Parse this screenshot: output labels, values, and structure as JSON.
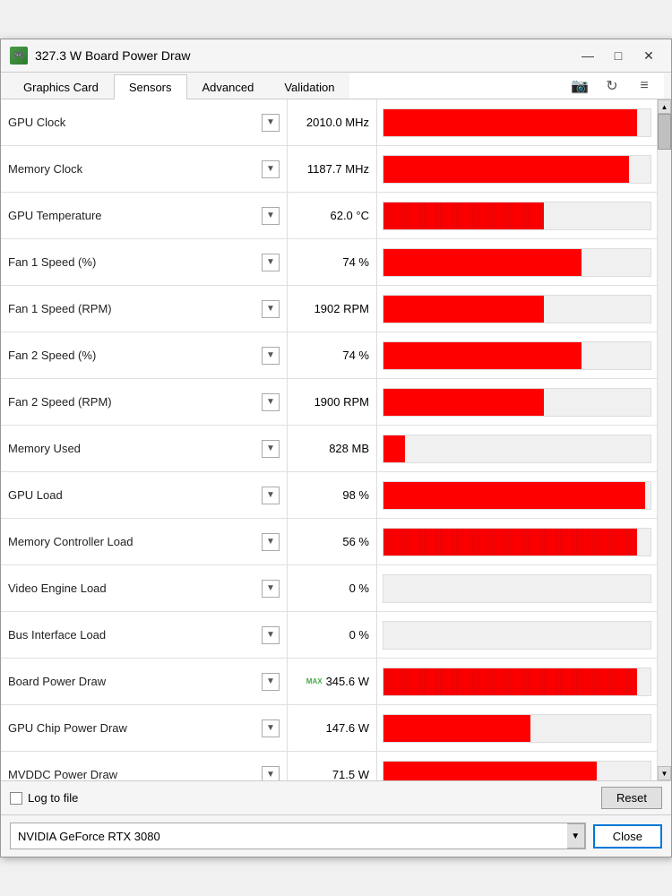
{
  "window": {
    "title": "327.3 W Board Power Draw",
    "icon_label": "GPU"
  },
  "controls": {
    "minimize": "—",
    "maximize": "□",
    "close": "✕"
  },
  "tabs": [
    {
      "id": "graphics-card",
      "label": "Graphics Card",
      "active": false
    },
    {
      "id": "sensors",
      "label": "Sensors",
      "active": true
    },
    {
      "id": "advanced",
      "label": "Advanced",
      "active": false
    },
    {
      "id": "validation",
      "label": "Validation",
      "active": false
    }
  ],
  "toolbar": {
    "camera_icon": "📷",
    "refresh_icon": "↻",
    "menu_icon": "≡"
  },
  "sensors": [
    {
      "name": "GPU Clock",
      "value": "2010.0 MHz",
      "bar_pct": 95,
      "noisy": false,
      "show_max": false
    },
    {
      "name": "Memory Clock",
      "value": "1187.7 MHz",
      "bar_pct": 92,
      "noisy": false,
      "show_max": false
    },
    {
      "name": "GPU Temperature",
      "value": "62.0 °C",
      "bar_pct": 60,
      "noisy": true,
      "show_max": false
    },
    {
      "name": "Fan 1 Speed (%)",
      "value": "74 %",
      "bar_pct": 74,
      "noisy": false,
      "show_max": false
    },
    {
      "name": "Fan 1 Speed (RPM)",
      "value": "1902 RPM",
      "bar_pct": 60,
      "noisy": false,
      "show_max": false
    },
    {
      "name": "Fan 2 Speed (%)",
      "value": "74 %",
      "bar_pct": 74,
      "noisy": false,
      "show_max": false
    },
    {
      "name": "Fan 2 Speed (RPM)",
      "value": "1900 RPM",
      "bar_pct": 60,
      "noisy": false,
      "show_max": false
    },
    {
      "name": "Memory Used",
      "value": "828 MB",
      "bar_pct": 8,
      "noisy": false,
      "show_max": false
    },
    {
      "name": "GPU Load",
      "value": "98 %",
      "bar_pct": 98,
      "noisy": false,
      "show_max": false
    },
    {
      "name": "Memory Controller Load",
      "value": "56 %",
      "bar_pct": 95,
      "noisy": true,
      "show_max": false
    },
    {
      "name": "Video Engine Load",
      "value": "0 %",
      "bar_pct": 0,
      "noisy": false,
      "show_max": false
    },
    {
      "name": "Bus Interface Load",
      "value": "0 %",
      "bar_pct": 0,
      "noisy": false,
      "show_max": false
    },
    {
      "name": "Board Power Draw",
      "value": "345.6 W",
      "bar_pct": 95,
      "noisy": true,
      "show_max": true
    },
    {
      "name": "GPU Chip Power Draw",
      "value": "147.6 W",
      "bar_pct": 55,
      "noisy": false,
      "show_max": false
    },
    {
      "name": "MVDDC Power Draw",
      "value": "71.5 W",
      "bar_pct": 80,
      "noisy": false,
      "show_max": false
    }
  ],
  "footer": {
    "log_label": "Log to file",
    "reset_label": "Reset"
  },
  "bottom": {
    "gpu_name": "NVIDIA GeForce RTX 3080",
    "close_label": "Close"
  }
}
